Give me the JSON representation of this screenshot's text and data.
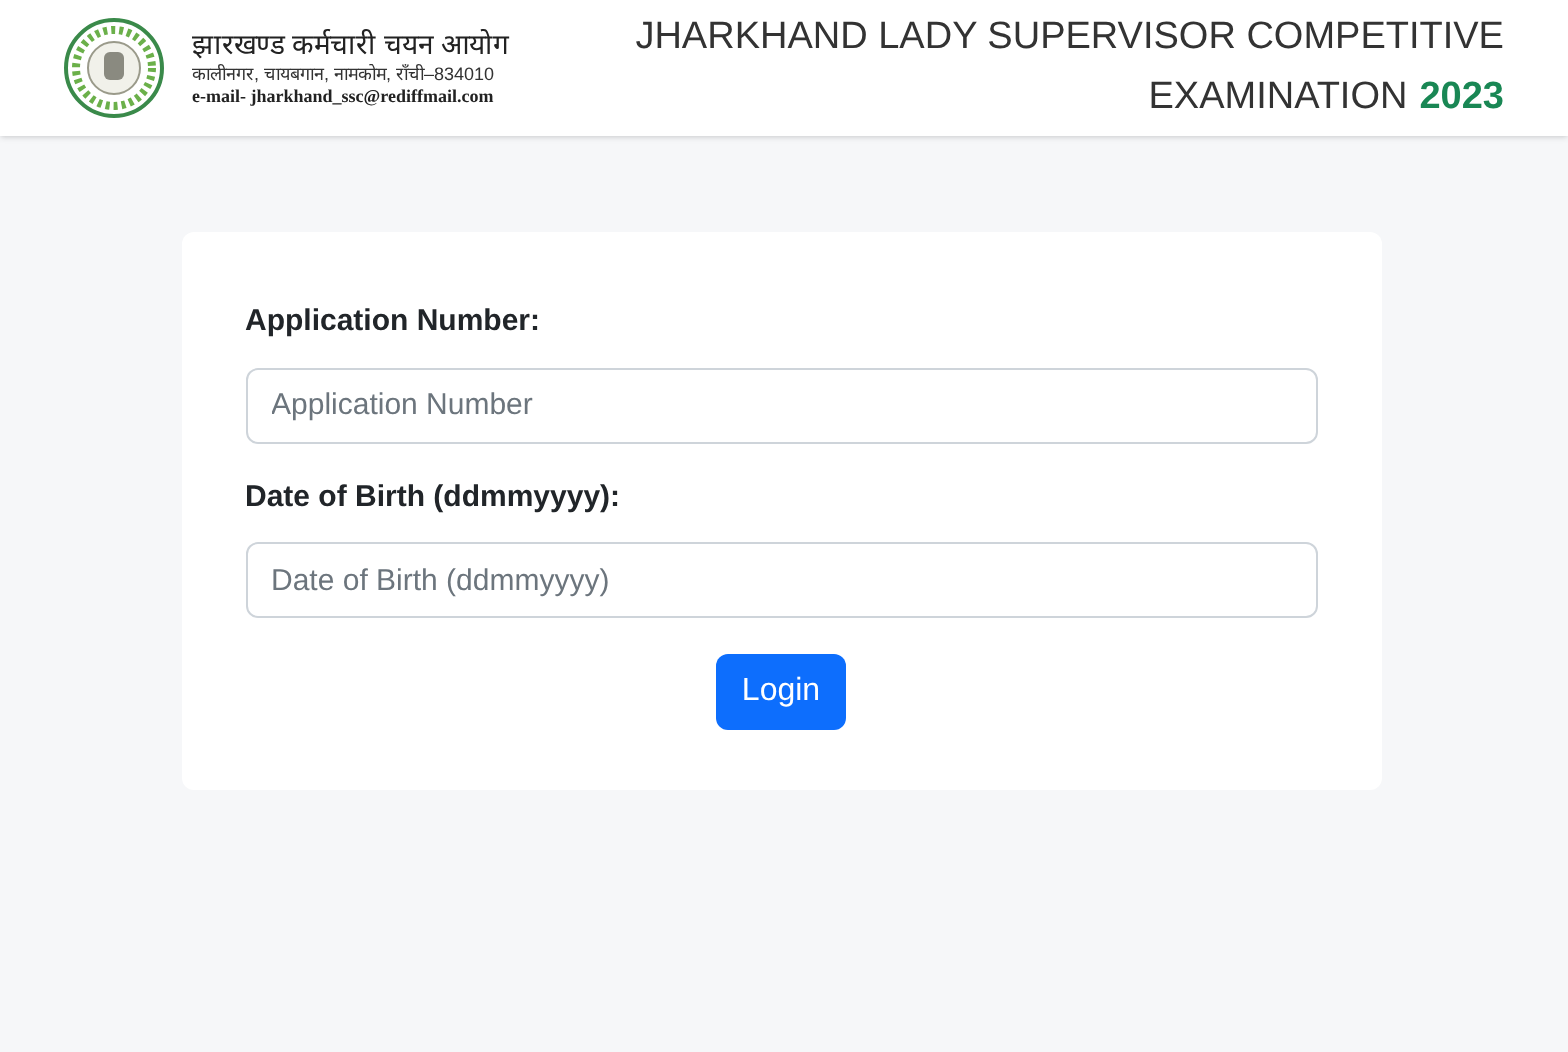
{
  "header": {
    "org_name": "झारखण्ड कर्मचारी चयन आयोग",
    "org_address": "कालीनगर, चायबगान, नामकोम, राँची–834010",
    "org_email": "e-mail- jharkhand_ssc@rediffmail.com",
    "title_line1": "JHARKHAND LADY SUPERVISOR COMPETITIVE",
    "title_line2": "EXAMINATION",
    "title_year": "2023"
  },
  "form": {
    "fields": [
      {
        "label": "Application Number:",
        "placeholder": "Application Number"
      },
      {
        "label": "Date of Birth (ddmmyyyy):",
        "placeholder": "Date of Birth (ddmmyyyy)"
      }
    ],
    "button": "Login"
  }
}
